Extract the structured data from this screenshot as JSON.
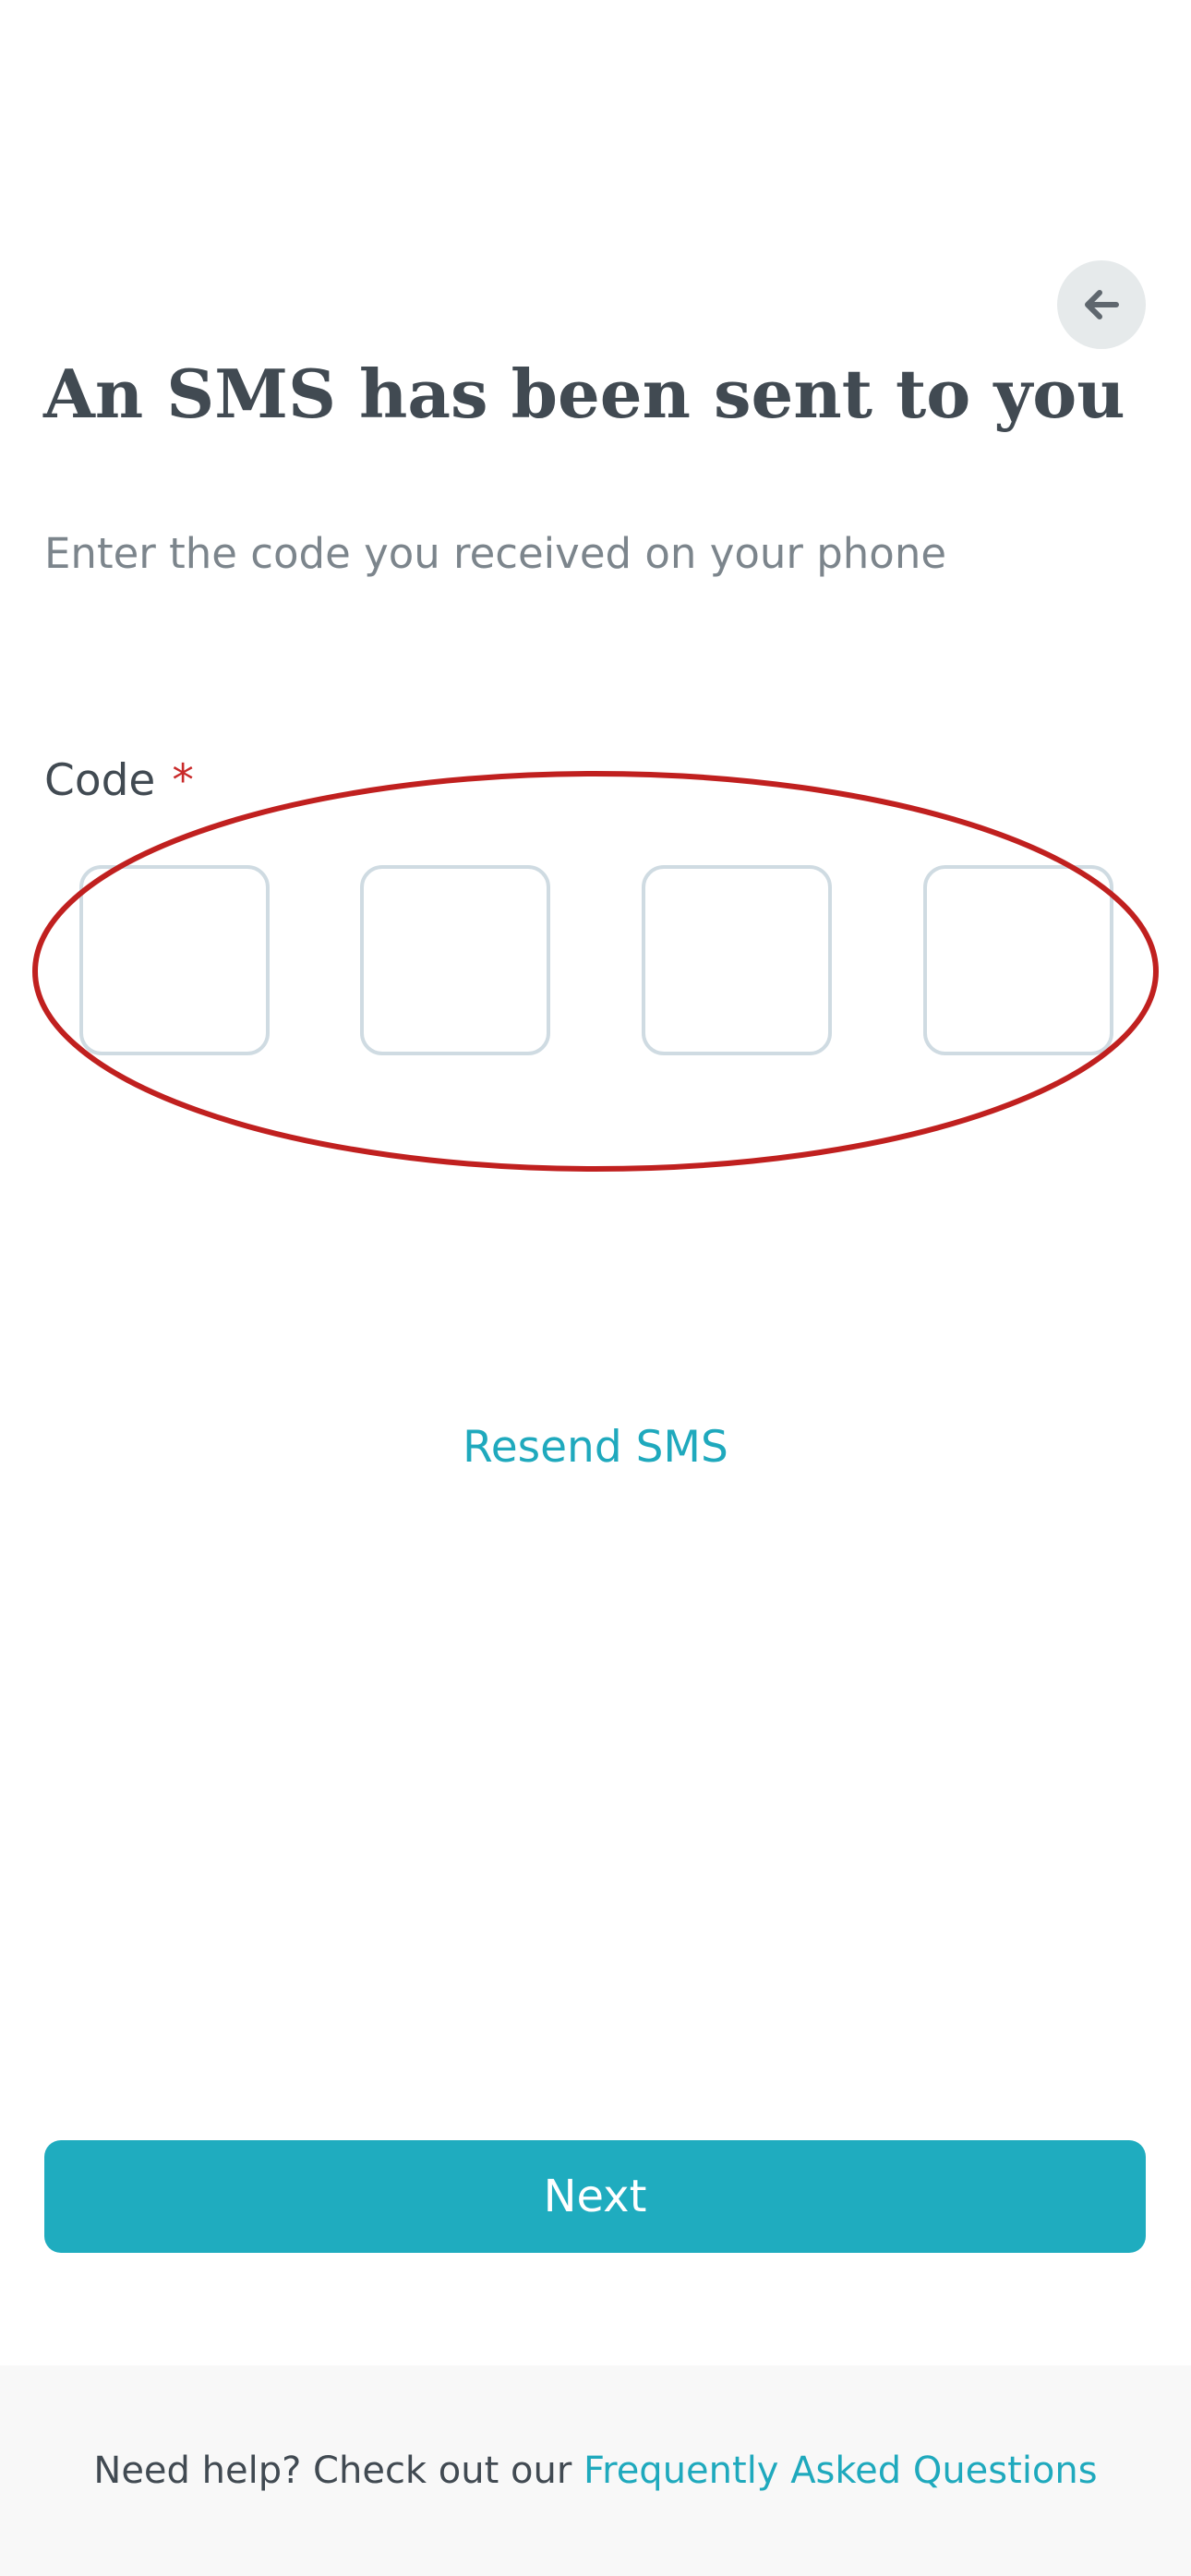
{
  "header": {
    "back_icon": "arrow-left-icon"
  },
  "content": {
    "title": "An SMS has been sent to you",
    "subtitle": "Enter the code you received on your phone",
    "code_label": "Code",
    "required_mark": "*",
    "code_digits": [
      "",
      "",
      "",
      ""
    ],
    "resend_label": "Resend SMS",
    "highlight_color": "#c0201f"
  },
  "actions": {
    "next_label": "Next"
  },
  "footer": {
    "help_text": "Need help? Check out our",
    "faq_link": "Frequently Asked Questions"
  },
  "colors": {
    "accent": "#1facbf",
    "text": "#414a52",
    "muted": "#7c858c",
    "required": "#c92a2a",
    "box_border": "#cfdbe2",
    "footer_bg": "#f8f8f8"
  }
}
